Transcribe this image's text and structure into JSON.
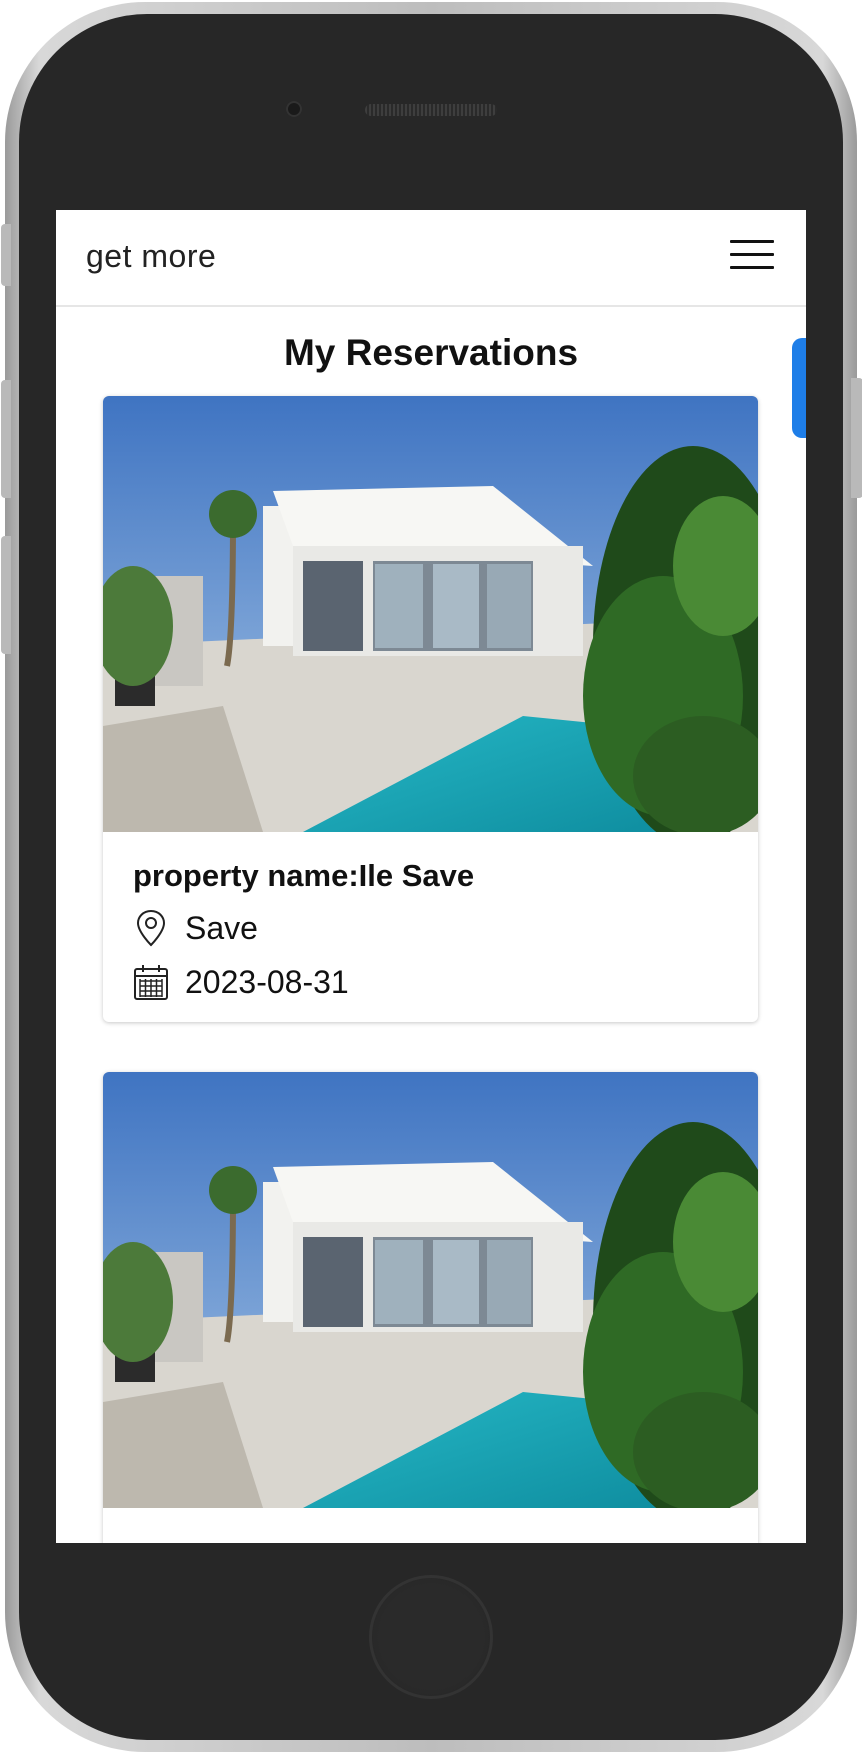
{
  "navbar": {
    "brand": "get more",
    "menu_icon": "hamburger-menu-icon"
  },
  "page": {
    "title": "My Reservations"
  },
  "reservations": [
    {
      "property_name": "property name:Ile Save",
      "location": "Save",
      "date": "2023-08-31",
      "image": "villa-with-pool-photo"
    },
    {
      "image": "villa-with-pool-photo"
    }
  ],
  "icons": [
    "location-pin-icon",
    "calendar-icon"
  ],
  "colors": {
    "accent": "#1e7ee8",
    "phone_frame": "#272727"
  }
}
